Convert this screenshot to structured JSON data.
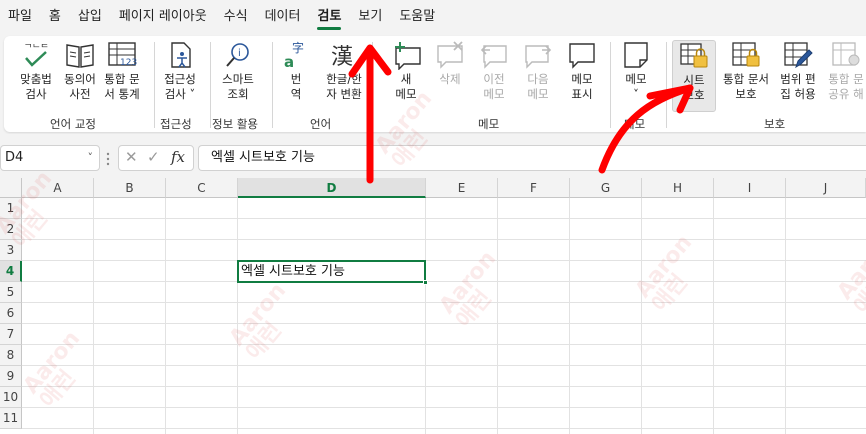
{
  "menu": {
    "items": [
      "파일",
      "홈",
      "삽입",
      "페이지 레이아웃",
      "수식",
      "데이터",
      "검토",
      "보기",
      "도움말"
    ],
    "active_index": 6
  },
  "ribbon": {
    "buttons": [
      {
        "label": "맞춤법\n검사",
        "icon": "spellcheck-icon",
        "enabled": true
      },
      {
        "label": "동의어\n사전",
        "icon": "thesaurus-icon",
        "enabled": true
      },
      {
        "label": "통합 문\n서 통계",
        "icon": "workbook-statistics-icon",
        "enabled": true
      },
      {
        "label": "접근성\n검사 ˅",
        "icon": "accessibility-icon",
        "enabled": true
      },
      {
        "label": "스마트\n조회",
        "icon": "smart-lookup-icon",
        "enabled": true
      },
      {
        "label": "번\n역",
        "icon": "translate-icon",
        "enabled": true
      },
      {
        "label": "한글/한\n자 변환",
        "icon": "hanja-convert-icon",
        "enabled": true
      },
      {
        "label": "새\n메모",
        "icon": "new-comment-icon",
        "enabled": true
      },
      {
        "label": "삭제",
        "icon": "delete-comment-icon",
        "enabled": false
      },
      {
        "label": "이전\n메모",
        "icon": "previous-comment-icon",
        "enabled": false
      },
      {
        "label": "다음\n메모",
        "icon": "next-comment-icon",
        "enabled": false
      },
      {
        "label": "메모\n표시",
        "icon": "show-comments-icon",
        "enabled": true
      },
      {
        "label": "메모\n˅",
        "icon": "notes-icon",
        "enabled": true
      },
      {
        "label": "시트\n보호",
        "icon": "protect-sheet-icon",
        "enabled": true
      },
      {
        "label": "통합 문서\n보호",
        "icon": "protect-workbook-icon",
        "enabled": true
      },
      {
        "label": "범위 편\n집 허용",
        "icon": "allow-edit-ranges-icon",
        "enabled": true
      },
      {
        "label": "통합 문\n공유 해",
        "icon": "unshare-workbook-icon",
        "enabled": false
      }
    ],
    "groups": [
      {
        "label": "언어 교정"
      },
      {
        "label": "접근성"
      },
      {
        "label": "정보 활용"
      },
      {
        "label": "언어"
      },
      {
        "label": "메모"
      },
      {
        "label": "메모"
      },
      {
        "label": "보호"
      }
    ]
  },
  "formula_bar": {
    "name_box": "D4",
    "name_box_dropdown": "˅",
    "cancel_glyph": "✕",
    "enter_glyph": "✓",
    "fx_glyph": "fx",
    "content": "엑셀 시트보호 기능"
  },
  "sheet": {
    "columns": [
      "A",
      "B",
      "C",
      "D",
      "E",
      "F",
      "G",
      "H",
      "I",
      "J"
    ],
    "rows": [
      "1",
      "2",
      "3",
      "4",
      "5",
      "6",
      "7",
      "8",
      "9",
      "10",
      "11"
    ],
    "selected_cell": "D4",
    "selected_column_index": 3,
    "selected_row_index": 3,
    "cell_D4": "엑셀 시트보호 기능"
  },
  "watermark": {
    "text": "Aaron\n애런"
  },
  "colors": {
    "accent": "#107c41",
    "annotation": "#ff0000",
    "ribbon_bg": "#f3f3f3"
  }
}
